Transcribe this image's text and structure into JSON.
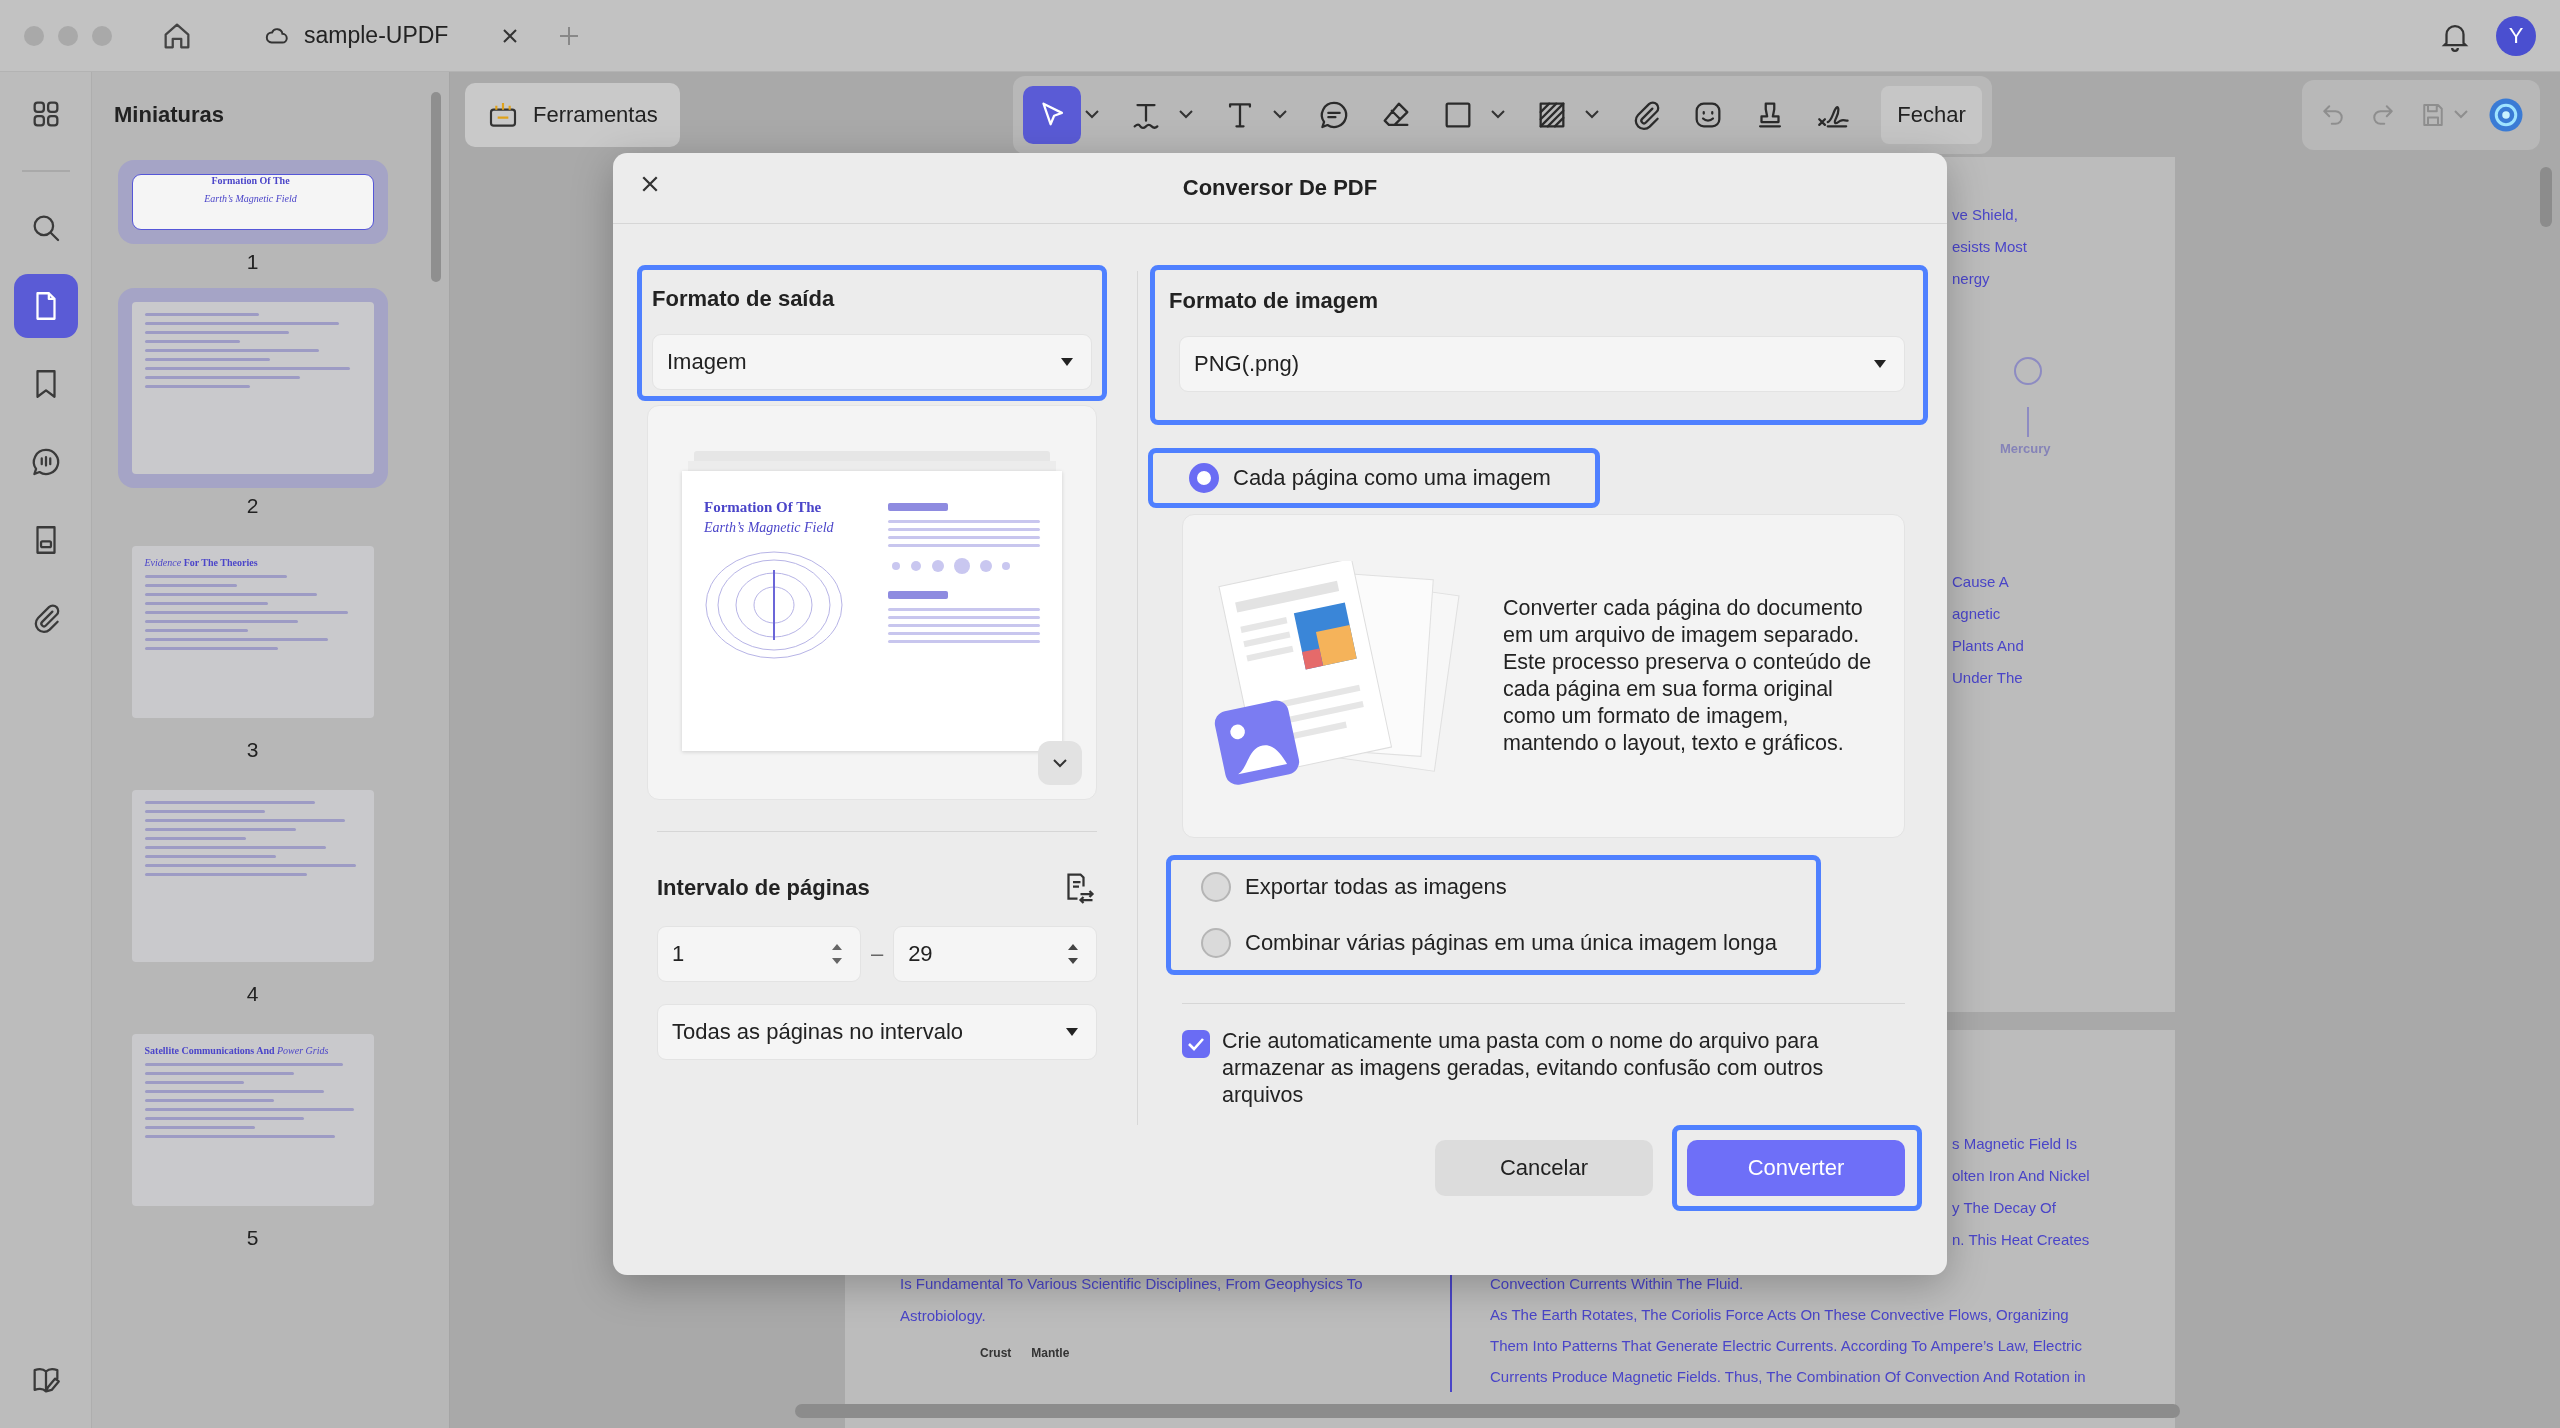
{
  "window": {
    "tab_title": "sample-UPDF",
    "avatar": "Y"
  },
  "rail": {
    "top": [
      {
        "kind": "grid",
        "selected": false
      }
    ],
    "middle": [
      {
        "kind": "search",
        "selected": false
      },
      {
        "kind": "pages",
        "selected": true
      },
      {
        "kind": "bookmark",
        "selected": false
      },
      {
        "kind": "comments",
        "selected": false
      },
      {
        "kind": "form",
        "selected": false
      },
      {
        "kind": "attachment",
        "selected": false
      }
    ],
    "bottom": [
      {
        "kind": "edit-book",
        "selected": false
      }
    ]
  },
  "sidebar": {
    "title": "Miniaturas",
    "thumbnails": [
      {
        "label": "1",
        "selected": true,
        "highlighted": true,
        "title": "**Formation Of The**",
        "subtitle": "Earth’s Magnetic Field"
      },
      {
        "label": "2",
        "selected": false,
        "highlighted": true
      },
      {
        "label": "3",
        "selected": false,
        "highlighted": false,
        "title": "*Evidence* **For The Theories**"
      },
      {
        "label": "4",
        "selected": false,
        "highlighted": false
      },
      {
        "label": "5",
        "selected": false,
        "highlighted": false,
        "title": "**Satellite Communications And** *Power Grids*"
      }
    ]
  },
  "toolbar": {
    "tools_button": "Ferramentas",
    "tools": [
      {
        "kind": "select",
        "selected": true,
        "menu": true
      },
      {
        "kind": "text-underline",
        "selected": false,
        "menu": true
      },
      {
        "kind": "text",
        "selected": false,
        "menu": true
      },
      {
        "kind": "comment",
        "selected": false,
        "menu": false
      },
      {
        "kind": "eraser",
        "selected": false,
        "menu": false
      },
      {
        "kind": "rectangle",
        "selected": false,
        "menu": true
      },
      {
        "kind": "hatch",
        "selected": false,
        "menu": true
      },
      {
        "kind": "attachment",
        "selected": false,
        "menu": false
      },
      {
        "kind": "sticker",
        "selected": false,
        "menu": false
      },
      {
        "kind": "stamp",
        "selected": false,
        "menu": false
      },
      {
        "kind": "signature",
        "selected": false,
        "menu": false
      }
    ],
    "close_button": "Fechar",
    "history": [
      {
        "kind": "undo",
        "disabled": true,
        "menu": false
      },
      {
        "kind": "redo",
        "disabled": true,
        "menu": false
      },
      {
        "kind": "save",
        "disabled": true,
        "menu": true
      },
      {
        "kind": "ai"
      }
    ]
  },
  "document": {
    "page1_top": [
      "ve Shield,",
      "esists Most",
      "nergy"
    ],
    "planet_label": "Mercury",
    "page1_middle": [
      "Cause A",
      "agnetic",
      "Plants And",
      "Under The"
    ],
    "page2_top": [
      "s Magnetic Field Is",
      "olten Iron And Nickel",
      "y The Decay Of",
      "n. This Heat Creates"
    ],
    "left_column": [
      "Is Fundamental To Various Scientific Disciplines, From Geophysics To",
      "Astrobiology."
    ],
    "diagram_labels": [
      "Crust",
      "Mantle"
    ],
    "right_column": [
      "Convection Currents Within The Fluid.",
      "As The Earth Rotates, The Coriolis Force Acts On These Convective Flows, Organizing",
      "Them Into Patterns That Generate Electric Currents. According To Ampere’s Law, Electric",
      "Currents Produce Magnetic Fields. Thus, The Combination Of Convection And Rotation in"
    ]
  },
  "dialog": {
    "title": "Conversor De PDF",
    "output_format": {
      "label": "Formato de saída",
      "value": "Imagem",
      "highlighted": true
    },
    "preview": {
      "title": "Formation Of The",
      "subtitle": "Earth’s Magnetic Field"
    },
    "page_range": {
      "label": "Intervalo de páginas",
      "from": "1",
      "to": "29",
      "separator": "–",
      "scope": "Todas as páginas no intervalo"
    },
    "image_format": {
      "label": "Formato de imagem",
      "value": "PNG(.png)",
      "highlighted": true
    },
    "mode_groups": [
      {
        "highlighted": true,
        "options": [
          {
            "label": "Cada página como uma imagem",
            "selected": true
          }
        ]
      },
      {
        "highlighted": true,
        "options": [
          {
            "label": "Exportar todas as imagens",
            "selected": false
          },
          {
            "label": "Combinar várias páginas em uma única imagem longa",
            "selected": false
          }
        ]
      }
    ],
    "description": "Converter cada página do documento em um arquivo de imagem separado. Este processo preserva o conteúdo de cada página em sua forma original como um formato de imagem, mantendo o layout, texto e gráficos.",
    "auto_folder": {
      "label": "Crie automaticamente uma pasta com o nome do arquivo para armazenar as imagens geradas, evitando confusão com outros arquivos",
      "checked": true
    },
    "buttons": [
      {
        "label": "Cancelar",
        "kind": "secondary",
        "highlighted": false
      },
      {
        "label": "Converter",
        "kind": "primary",
        "highlighted": true
      }
    ]
  }
}
